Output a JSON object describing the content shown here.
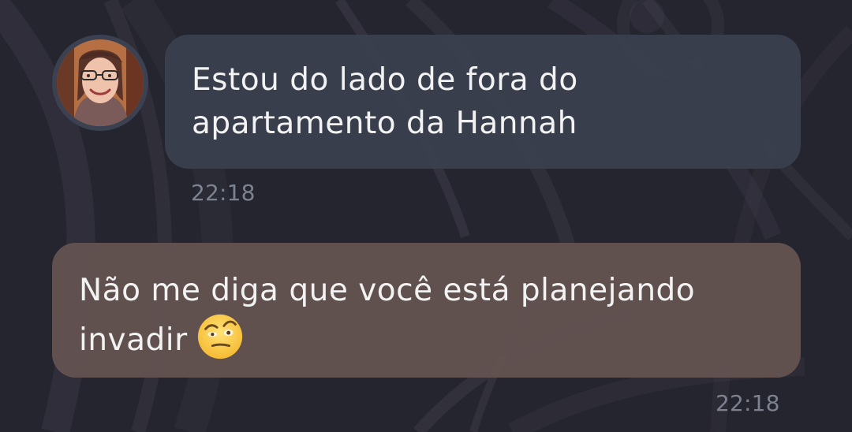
{
  "conversation": {
    "messages": [
      {
        "text": "Estou do lado de fora do apartamento da Hannah",
        "time": "22:18"
      },
      {
        "text": "Não me diga que você está planejando invadir",
        "emoji": "face-with-raised-eyebrow",
        "time": "22:18"
      }
    ]
  },
  "colors": {
    "background": "#25252f",
    "incoming_bubble": "#3a3f4e",
    "outgoing_bubble": "#625351",
    "text": "#f2f2f2",
    "timestamp": "#7d8290"
  }
}
